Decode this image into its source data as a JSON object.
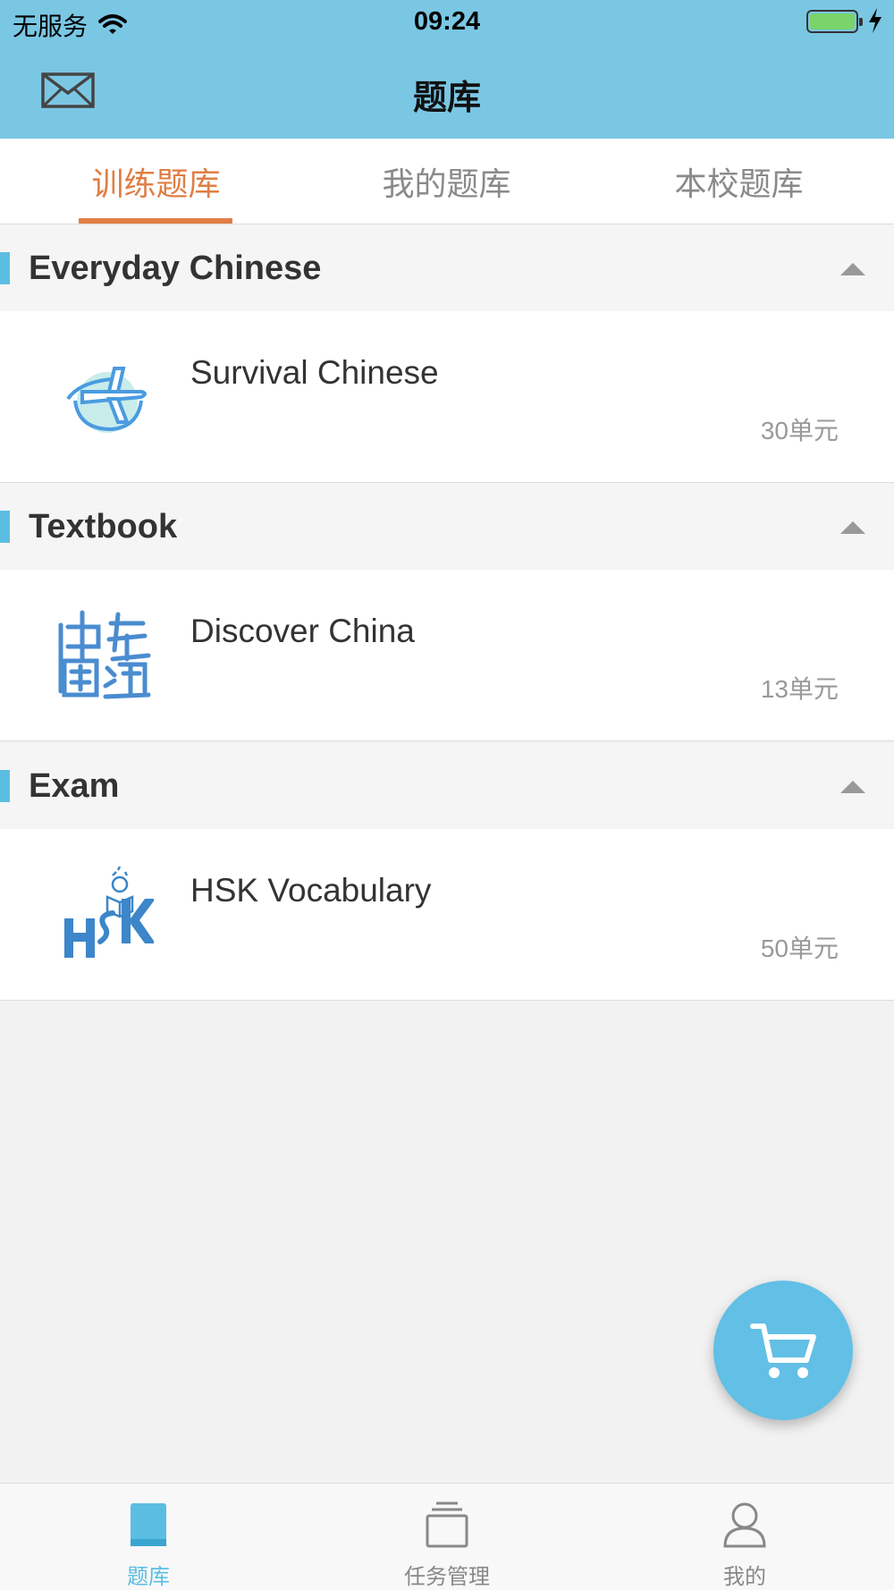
{
  "status_bar": {
    "carrier": "无服务",
    "time": "09:24"
  },
  "nav": {
    "title": "题库",
    "mail_icon": "mail-icon"
  },
  "tabs": [
    {
      "label": "训练题库",
      "active": true
    },
    {
      "label": "我的题库",
      "active": false
    },
    {
      "label": "本校题库",
      "active": false
    }
  ],
  "sections": [
    {
      "title": "Everyday Chinese",
      "items": [
        {
          "title": "Survival Chinese",
          "count": "30单元",
          "icon": "airplane-globe-logo"
        }
      ]
    },
    {
      "title": "Textbook",
      "items": [
        {
          "title": "Discover China",
          "count": "13单元",
          "icon": "calligraphy-seal-logo"
        }
      ]
    },
    {
      "title": "Exam",
      "items": [
        {
          "title": "HSK Vocabulary",
          "count": "50单元",
          "icon": "hsk-logo"
        }
      ]
    }
  ],
  "fab": {
    "icon": "cart-icon"
  },
  "tabbar": [
    {
      "label": "题库",
      "icon": "book-icon",
      "active": true
    },
    {
      "label": "任务管理",
      "icon": "folder-stack-icon",
      "active": false
    },
    {
      "label": "我的",
      "icon": "person-icon",
      "active": false
    }
  ],
  "colors": {
    "header": "#7ac7e4",
    "accent": "#5cbde2",
    "active_tab": "#e07e45"
  }
}
